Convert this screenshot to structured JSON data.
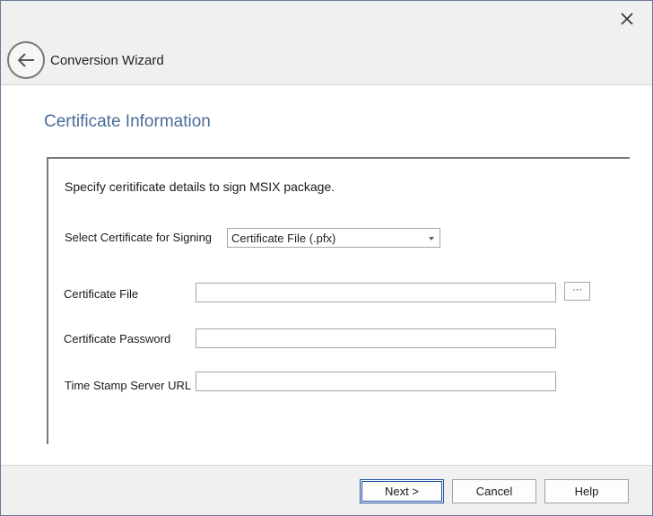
{
  "window": {
    "title": "Conversion Wizard"
  },
  "page": {
    "title": "Certificate Information",
    "instruction": "Specify ceritificate details to sign MSIX package."
  },
  "form": {
    "select_certificate_label": "Select Certificate for Signing",
    "select_certificate_value": "Certificate File (.pfx)",
    "certificate_file_label": "Certificate File",
    "certificate_file_value": "",
    "browse_label": "···",
    "certificate_password_label": "Certificate Password",
    "certificate_password_value": "",
    "timestamp_url_label": "Time Stamp Server URL",
    "timestamp_url_value": ""
  },
  "footer": {
    "next_label": "Next >",
    "cancel_label": "Cancel",
    "help_label": "Help"
  },
  "colors": {
    "title_accent": "#4a6d97",
    "primary_border": "#1f4f9f"
  },
  "icons": {
    "close": "close-icon",
    "back": "back-arrow-icon",
    "dropdown": "chevron-down-icon"
  }
}
